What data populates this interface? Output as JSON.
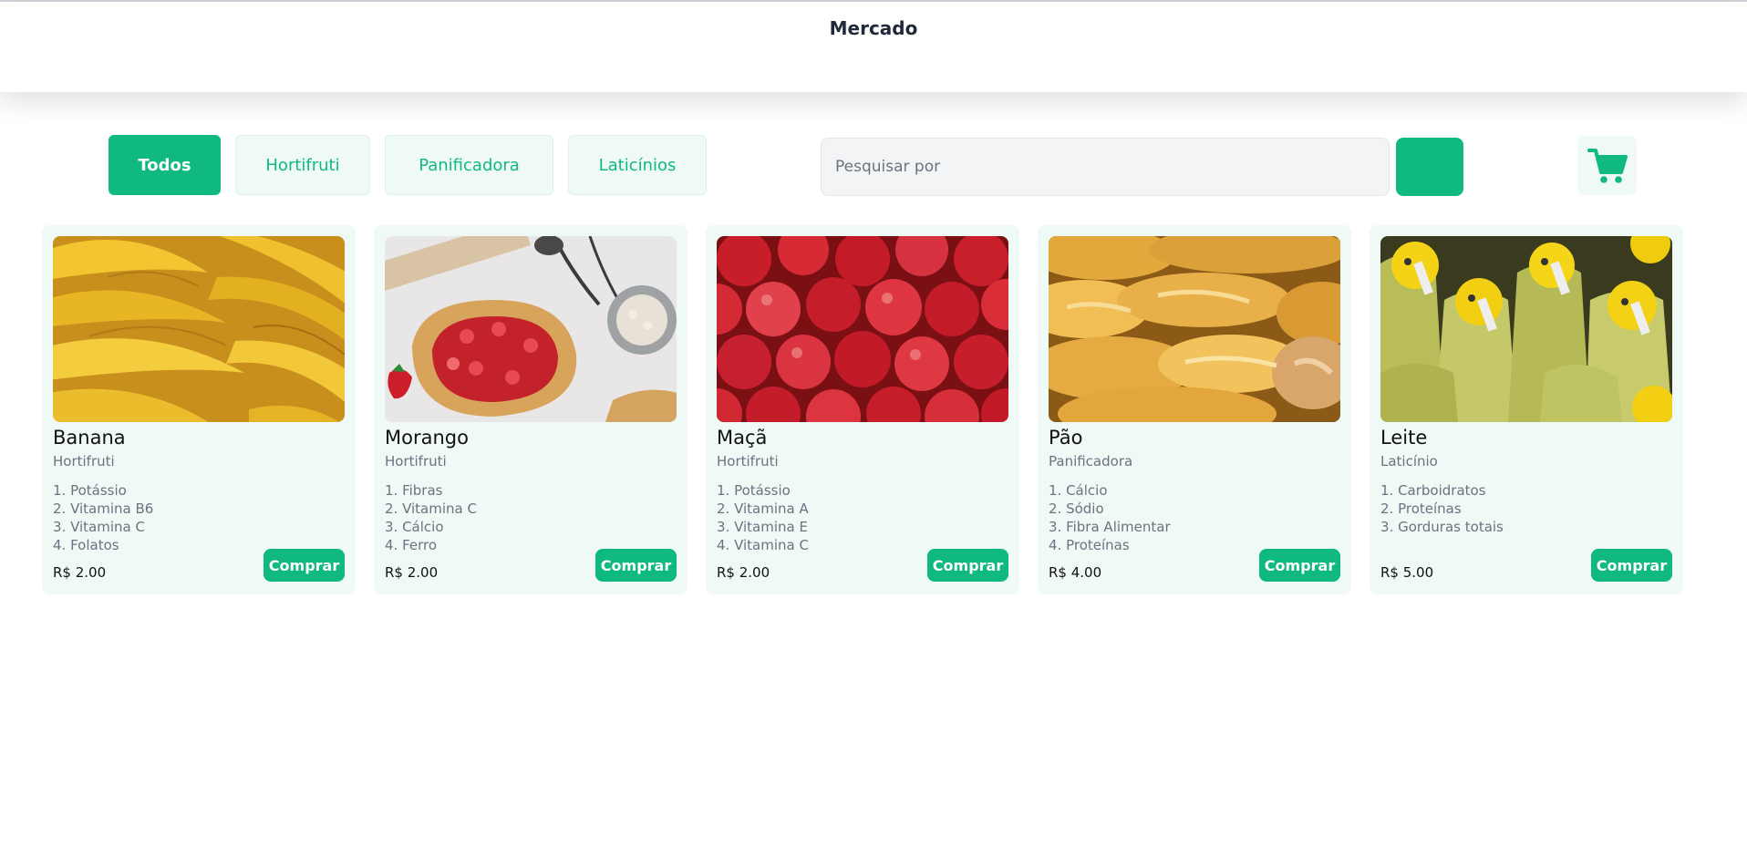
{
  "app": {
    "title": "Mercado"
  },
  "filters": [
    "Todos",
    "Hortifruti",
    "Panificadora",
    "Laticínios"
  ],
  "active_filter": "Todos",
  "search": {
    "placeholder": "Pesquisar por",
    "value": ""
  },
  "icons": {
    "cart": "shopping-cart-icon"
  },
  "colors": {
    "accent": "#10b981",
    "accent_light": "#effaf6",
    "text_muted": "#6b7280"
  },
  "buy_label": "Comprar",
  "products": [
    {
      "name": "Banana",
      "category": "Hortifruti",
      "nutrients": [
        "1. Potássio",
        "2. Vitamina B6",
        "3. Vitamina C",
        "4. Folatos"
      ],
      "price": "R$ 2.00",
      "image": "banana-image"
    },
    {
      "name": "Morango",
      "category": "Hortifruti",
      "nutrients": [
        "1. Fibras",
        "2. Vitamina C",
        "3. Cálcio",
        "4. Ferro"
      ],
      "price": "R$ 2.00",
      "image": "strawberry-tart-image"
    },
    {
      "name": "Maçã",
      "category": "Hortifruti",
      "nutrients": [
        "1. Potássio",
        "2. Vitamina A",
        "3. Vitamina E",
        "4. Vitamina C"
      ],
      "price": "R$ 2.00",
      "image": "apples-image"
    },
    {
      "name": "Pão",
      "category": "Panificadora",
      "nutrients": [
        "1. Cálcio",
        "2. Sódio",
        "3. Fibra Alimentar",
        "4. Proteínas"
      ],
      "price": "R$ 4.00",
      "image": "bread-image"
    },
    {
      "name": "Leite",
      "category": "Laticínio",
      "nutrients": [
        "1. Carboidratos",
        "2. Proteínas",
        "3. Gorduras totais"
      ],
      "price": "R$ 5.00",
      "image": "milk-bottles-image"
    }
  ]
}
